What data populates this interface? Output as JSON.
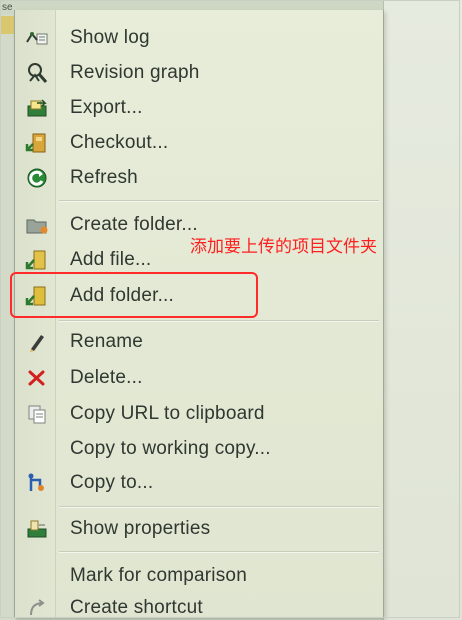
{
  "background": {
    "window_label": "se"
  },
  "menu": {
    "items": [
      {
        "label": "Show log",
        "icon": "show-log-icon"
      },
      {
        "label": "Revision graph",
        "icon": "revision-graph-icon"
      },
      {
        "label": "Export...",
        "icon": "export-icon"
      },
      {
        "label": "Checkout...",
        "icon": "checkout-icon"
      },
      {
        "label": "Refresh",
        "icon": "refresh-icon"
      },
      {
        "label": "Create folder...",
        "icon": "create-folder-icon"
      },
      {
        "label": "Add file...",
        "icon": "add-file-icon"
      },
      {
        "label": "Add folder...",
        "icon": "add-folder-icon"
      },
      {
        "label": "Rename",
        "icon": "rename-icon"
      },
      {
        "label": "Delete...",
        "icon": "delete-icon"
      },
      {
        "label": "Copy URL to clipboard",
        "icon": "copy-url-icon"
      },
      {
        "label": "Copy to working copy...",
        "icon": ""
      },
      {
        "label": "Copy to...",
        "icon": "copy-to-icon"
      },
      {
        "label": "Show properties",
        "icon": "show-properties-icon"
      },
      {
        "label": "Mark for comparison",
        "icon": ""
      },
      {
        "label": "Create shortcut",
        "icon": "create-shortcut-icon"
      }
    ]
  },
  "annotation": {
    "text": "添加要上传的项目文件夹"
  },
  "colors": {
    "menu_bg": "#e3e9d4",
    "annotation_red": "#ff1f1f",
    "highlight_red": "#ff2a2a",
    "text": "#2f3831"
  }
}
